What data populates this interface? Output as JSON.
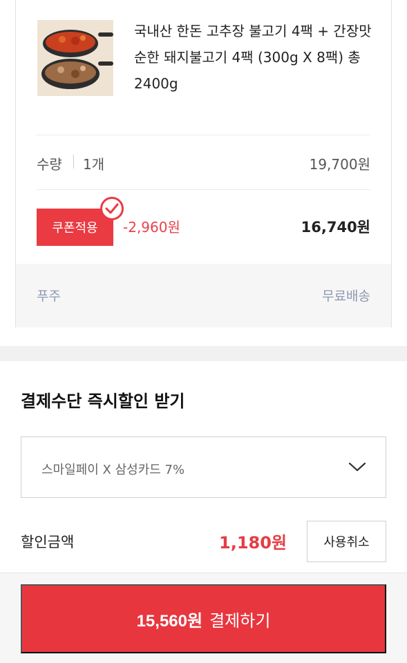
{
  "product": {
    "title": "국내산 한돈 고추장 불고기 4팩 + 간장맛 순한 돼지불고기 4팩 (300g X 8팩) 총 2400g",
    "image_icon": "bulgogi-dish-thumbnail",
    "quantity_label": "수량",
    "quantity_value": "1개",
    "original_price": "19,700원",
    "coupon_label": "쿠폰적용",
    "coupon_discount": "-2,960원",
    "final_price": "16,740원",
    "shipping_type": "푸주",
    "shipping_fee": "무료배송"
  },
  "payment_discount": {
    "section_title": "결제수단 즉시할인 받기",
    "selected_method": "스마일페이 X 삼성카드 7%",
    "discount_label": "할인금액",
    "discount_amount": "1,180원",
    "cancel_label": "사용취소"
  },
  "checkout": {
    "amount": "15,560원",
    "action_label": "결제하기"
  },
  "colors": {
    "accent_red": "#e8363f",
    "muted_blue": "#8c9ab3"
  }
}
